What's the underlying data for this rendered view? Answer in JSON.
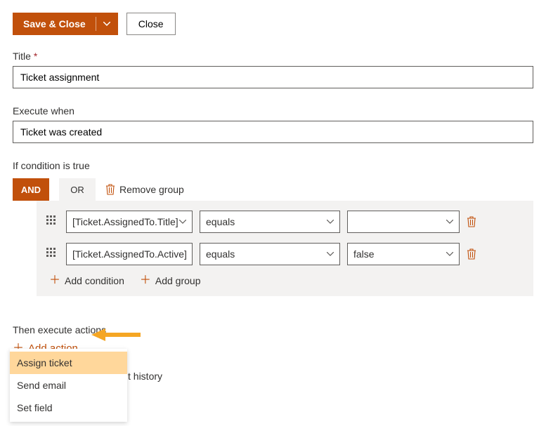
{
  "toolbar": {
    "save_close": "Save & Close",
    "close": "Close"
  },
  "fields": {
    "title_label": "Title",
    "required_mark": "*",
    "title_value": "Ticket assignment",
    "execute_when_label": "Execute when",
    "execute_when_value": "Ticket was created"
  },
  "condition": {
    "section_label": "If condition is true",
    "and": "AND",
    "or": "OR",
    "remove_group": "Remove group",
    "rows": [
      {
        "field": "[Ticket.AssignedTo.Title]",
        "operator": "equals",
        "value": ""
      },
      {
        "field": "[Ticket.AssignedTo.Active]",
        "operator": "equals",
        "value": "false"
      }
    ],
    "add_condition": "Add condition",
    "add_group": "Add group"
  },
  "actions": {
    "section_label": "Then execute actions",
    "add_action": "Add action",
    "menu": [
      "Assign ticket",
      "Send email",
      "Set field"
    ],
    "behind_text": "t history"
  },
  "colors": {
    "accent": "#c1500b",
    "panel": "#f3f2f1",
    "highlight": "#ffd79b",
    "arrow": "#f5a623"
  }
}
